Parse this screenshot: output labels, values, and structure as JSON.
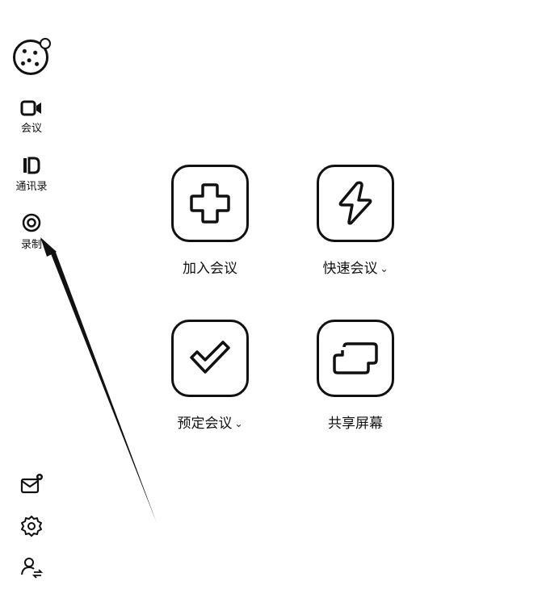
{
  "sidebar": {
    "avatar_icon": "user-avatar",
    "items": [
      {
        "label": "会议",
        "icon": "video-camera-icon"
      },
      {
        "label": "通讯录",
        "icon": "contacts-icon"
      },
      {
        "label": "录制",
        "icon": "record-icon"
      }
    ],
    "bottom": [
      {
        "icon": "mail-icon"
      },
      {
        "icon": "gear-icon"
      },
      {
        "icon": "user-switch-icon"
      }
    ]
  },
  "main": {
    "actions": [
      {
        "label": "加入会议",
        "icon": "plus-icon",
        "dropdown": false
      },
      {
        "label": "快速会议",
        "icon": "lightning-icon",
        "dropdown": true
      },
      {
        "label": "预定会议",
        "icon": "check-icon",
        "dropdown": true
      },
      {
        "label": "共享屏幕",
        "icon": "screen-share-icon",
        "dropdown": false
      }
    ]
  },
  "dropdown_glyph": "⌄"
}
